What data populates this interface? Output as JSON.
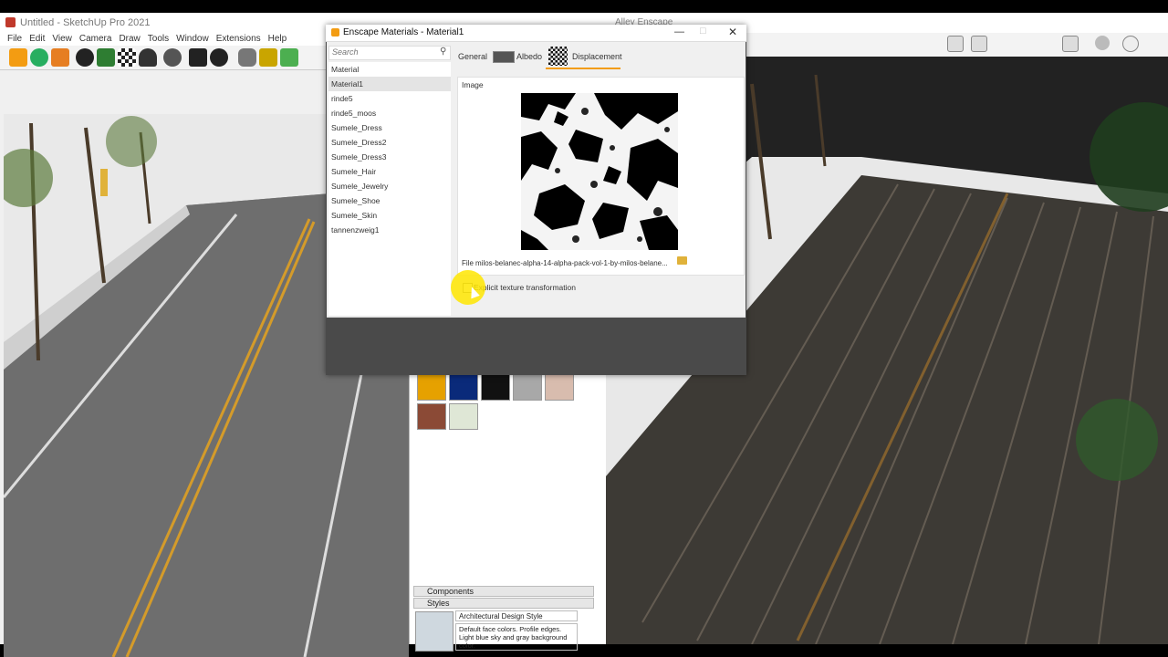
{
  "sketchup": {
    "title": "Untitled - SketchUp Pro 2021",
    "menu": [
      "File",
      "Edit",
      "View",
      "Camera",
      "Draw",
      "Tools",
      "Window",
      "Extensions",
      "Help"
    ]
  },
  "enscape_window": {
    "title": "Alley Enscape"
  },
  "dialog": {
    "title": "Enscape Materials - Material1",
    "search_placeholder": "Search",
    "materials": [
      "Material",
      "Material1",
      "rinde5",
      "rinde5_moos",
      "Sumele_Dress",
      "Sumele_Dress2",
      "Sumele_Dress3",
      "Sumele_Hair",
      "Sumele_Jewelry",
      "Sumele_Shoe",
      "Sumele_Skin",
      "tannenzweig1"
    ],
    "selected_material": "Material1",
    "tabs": [
      "General",
      "Albedo",
      "Displacement"
    ],
    "active_tab": "Displacement",
    "section_label": "Image",
    "file_label": "File",
    "file_name": "milos-belanec-alpha-14-alpha-pack-vol-1-by-milos-belane...",
    "checkbox_label": "Explicit texture transformation",
    "checkbox_checked": false
  },
  "tray": {
    "swatch_colors": [
      "#e6a100",
      "#0a2a7a",
      "#111111",
      "#a8a8a8",
      "#d8bcae",
      "#8b4a36"
    ],
    "components_label": "Components",
    "styles_label": "Styles",
    "style_name": "Architectural Design Style",
    "style_desc": "Default face colors. Profile edges. Light blue sky and gray background color."
  }
}
